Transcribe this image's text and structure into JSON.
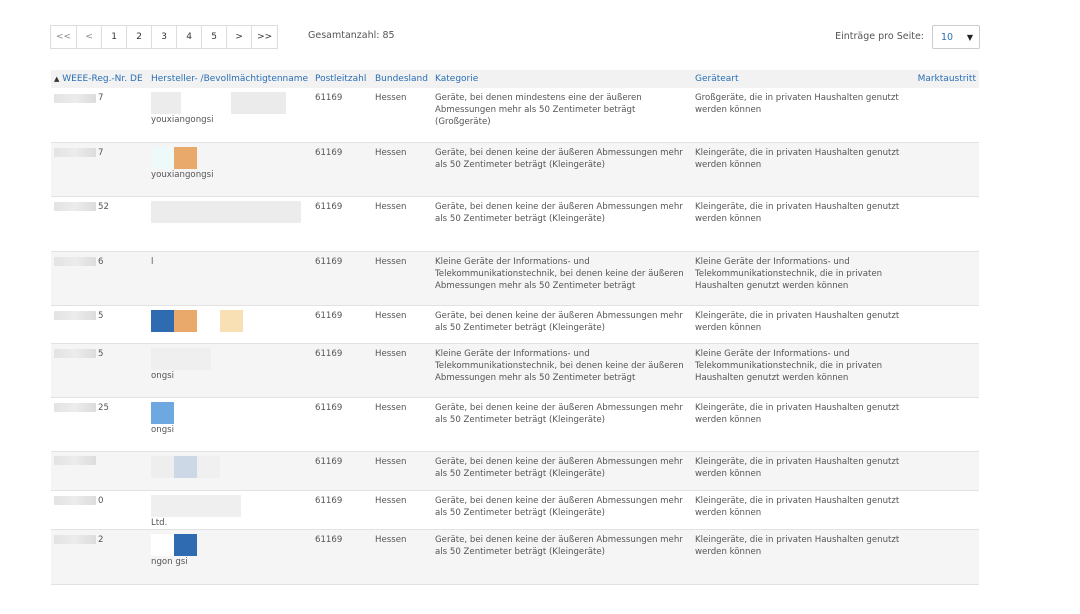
{
  "pagination": {
    "first": "<<",
    "prev": "<",
    "pages": [
      "1",
      "2",
      "3",
      "4",
      "5"
    ],
    "next": ">",
    "last": ">>",
    "total_label": "Gesamtanzahl: 85"
  },
  "per_page": {
    "label": "Einträge pro Seite:",
    "value": "10"
  },
  "table": {
    "headers": {
      "reg": "WEEE-Reg.-Nr. DE",
      "manufacturer": "Hersteller- /Bevollmächtigtenname",
      "zip": "Postleitzahl",
      "state": "Bundesland",
      "category": "Kategorie",
      "device_type": "Geräteart",
      "exit": "Marktaustritt"
    },
    "sort_icon": "sort-asc-icon",
    "rows": [
      {
        "reg_suffix": "7",
        "mfr_text": "youxiangongsi",
        "zip": "61169",
        "state": "Hessen",
        "category": "Geräte, bei denen mindestens eine der äußeren Abmessungen mehr als 50 Zentimeter beträgt (Großgeräte)",
        "device_type": "Großgeräte, die in privaten Haushalten genutzt werden können"
      },
      {
        "reg_suffix": "7",
        "mfr_text": "youxiangongsi",
        "zip": "61169",
        "state": "Hessen",
        "category": "Geräte, bei denen keine der äußeren Abmessungen mehr als 50 Zentimeter beträgt (Kleingeräte)",
        "device_type": "Kleingeräte, die in privaten Haushalten genutzt werden können"
      },
      {
        "reg_suffix": "52",
        "mfr_text": "",
        "zip": "61169",
        "state": "Hessen",
        "category": "Geräte, bei denen keine der äußeren Abmessungen mehr als 50 Zentimeter beträgt (Kleingeräte)",
        "device_type": "Kleingeräte, die in privaten Haushalten genutzt werden können"
      },
      {
        "reg_suffix": "6",
        "mfr_text": "l",
        "zip": "61169",
        "state": "Hessen",
        "category": "Kleine Geräte der Informations- und Telekommunikationstechnik, bei denen keine der äußeren Abmessungen mehr als 50 Zentimeter beträgt",
        "device_type": "Kleine Geräte der Informations- und Telekommunikationstechnik, die in privaten Haushalten genutzt werden können"
      },
      {
        "reg_suffix": "5",
        "mfr_text": "",
        "zip": "61169",
        "state": "Hessen",
        "category": "Geräte, bei denen keine der äußeren Abmessungen mehr als 50 Zentimeter beträgt (Kleingeräte)",
        "device_type": "Kleingeräte, die in privaten Haushalten genutzt werden können"
      },
      {
        "reg_suffix": "5",
        "mfr_text": "ongsi",
        "zip": "61169",
        "state": "Hessen",
        "category": "Kleine Geräte der Informations- und Telekommunikationstechnik, bei denen keine der äußeren Abmessungen mehr als 50 Zentimeter beträgt",
        "device_type": "Kleine Geräte der Informations- und Telekommunikationstechnik, die in privaten Haushalten genutzt werden können"
      },
      {
        "reg_suffix": "25",
        "mfr_text": "ongsi",
        "zip": "61169",
        "state": "Hessen",
        "category": "Geräte, bei denen keine der äußeren Abmessungen mehr als 50 Zentimeter beträgt (Kleingeräte)",
        "device_type": "Kleingeräte, die in privaten Haushalten genutzt werden können"
      },
      {
        "reg_suffix": "",
        "mfr_text": "",
        "zip": "61169",
        "state": "Hessen",
        "category": "Geräte, bei denen keine der äußeren Abmessungen mehr als 50 Zentimeter beträgt (Kleingeräte)",
        "device_type": "Kleingeräte, die in privaten Haushalten genutzt werden können"
      },
      {
        "reg_suffix": "0",
        "mfr_text": "Ltd.",
        "zip": "61169",
        "state": "Hessen",
        "category": "Geräte, bei denen keine der äußeren Abmessungen mehr als 50 Zentimeter beträgt (Kleingeräte)",
        "device_type": "Kleingeräte, die in privaten Haushalten genutzt werden können"
      },
      {
        "reg_suffix": "2",
        "mfr_text": "ngon gsi",
        "zip": "61169",
        "state": "Hessen",
        "category": "Geräte, bei denen keine der äußeren Abmessungen mehr als 50 Zentimeter beträgt (Kleingeräte)",
        "device_type": "Kleingeräte, die in privaten Haushalten genutzt werden können"
      }
    ]
  },
  "colors": {
    "link_blue": "#2a6fb5",
    "redact_orange": "#e9a96a",
    "redact_blue": "#2e6bb0",
    "redact_lightblue": "#6ea8e0",
    "redact_cream": "#f9e0b4"
  }
}
